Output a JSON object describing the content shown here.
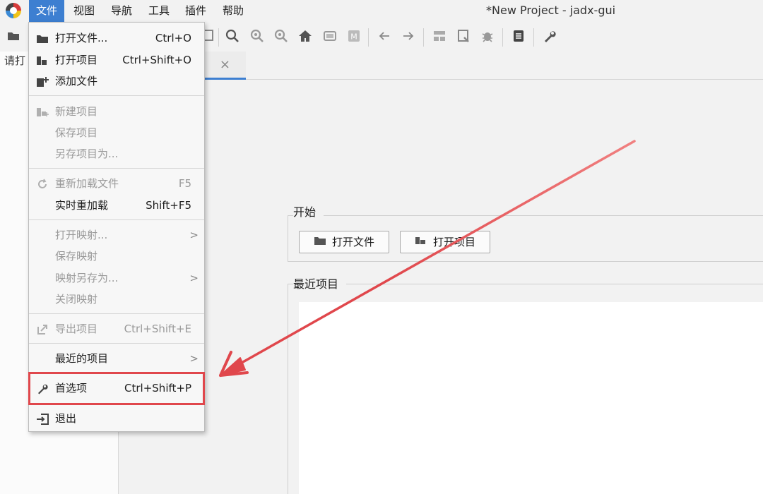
{
  "window": {
    "title": "*New Project - jadx-gui"
  },
  "menubar": {
    "items": [
      {
        "label": "文件",
        "active": true
      },
      {
        "label": "视图"
      },
      {
        "label": "导航"
      },
      {
        "label": "工具"
      },
      {
        "label": "插件"
      },
      {
        "label": "帮助"
      }
    ]
  },
  "toolbar": {
    "icons": [
      "open-folder-icon",
      "search-icon",
      "search-class-icon",
      "search-usage-icon",
      "home-icon",
      "window-icon",
      "mark-icon",
      "back-arrow-icon",
      "forward-arrow-icon",
      "quark-icon",
      "decompile-icon",
      "debug-icon",
      "log-icon",
      "wrench-icon"
    ]
  },
  "left_panel": {
    "text": "请打"
  },
  "file_menu": {
    "items": [
      {
        "label": "打开文件...",
        "shortcut": "Ctrl+O",
        "icon": "folder-open-icon",
        "enabled": true
      },
      {
        "label": "打开项目",
        "shortcut": "Ctrl+Shift+O",
        "icon": "project-open-icon",
        "enabled": true
      },
      {
        "label": "添加文件",
        "shortcut": "",
        "icon": "add-file-icon",
        "enabled": true
      },
      {
        "label": "新建项目",
        "shortcut": "",
        "icon": "new-project-icon",
        "enabled": false
      },
      {
        "label": "保存项目",
        "shortcut": "",
        "enabled": false
      },
      {
        "label": "另存项目为...",
        "shortcut": "",
        "enabled": false
      },
      {
        "label": "重新加载文件",
        "shortcut": "F5",
        "icon": "reload-icon",
        "enabled": false
      },
      {
        "label": "实时重加载",
        "shortcut": "Shift+F5",
        "enabled": true
      },
      {
        "label": "打开映射...",
        "submenu": true,
        "enabled": false
      },
      {
        "label": "保存映射",
        "enabled": false
      },
      {
        "label": "映射另存为...",
        "submenu": true,
        "enabled": false
      },
      {
        "label": "关闭映射",
        "enabled": false
      },
      {
        "label": "导出项目",
        "shortcut": "Ctrl+Shift+E",
        "icon": "export-icon",
        "enabled": false
      },
      {
        "label": "最近的项目",
        "submenu": true,
        "enabled": true
      },
      {
        "label": "首选项",
        "shortcut": "Ctrl+Shift+P",
        "icon": "wrench-icon",
        "enabled": true,
        "highlighted": true
      },
      {
        "label": "退出",
        "icon": "exit-icon",
        "enabled": true
      }
    ]
  },
  "start_page": {
    "start_title": "开始",
    "open_file_button": "打开文件",
    "open_project_button": "打开项目",
    "recent_title": "最近项目"
  },
  "colors": {
    "accent": "#3d7fd1",
    "highlight": "#e0474c",
    "disabled_text": "#9a9a9a"
  }
}
